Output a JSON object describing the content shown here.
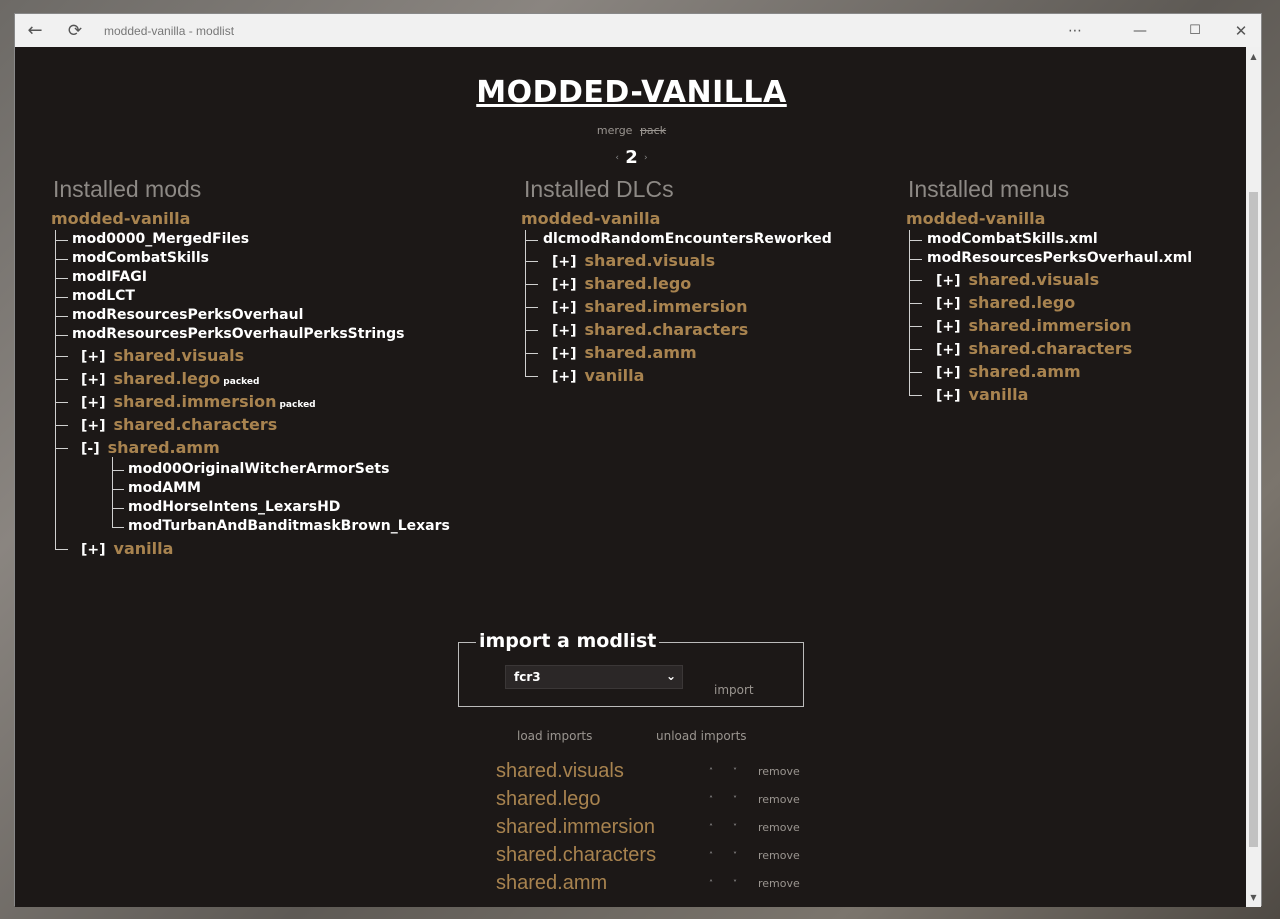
{
  "window": {
    "title": "modded-vanilla - modlist"
  },
  "page": {
    "title": "MODDED-VANILLA",
    "mode_merge": "merge",
    "mode_pack": "pack",
    "page_number": "2"
  },
  "columns": {
    "mods": {
      "heading": "Installed mods",
      "root": "modded-vanilla",
      "leaves": [
        "mod0000_MergedFiles",
        "modCombatSkills",
        "modIFAGI",
        "modLCT",
        "modResourcesPerksOverhaul",
        "modResourcesPerksOverhaulPerksStrings"
      ],
      "groups": [
        {
          "bracket": "[+]",
          "name": "shared.visuals",
          "tag": ""
        },
        {
          "bracket": "[+]",
          "name": "shared.lego",
          "tag": "packed"
        },
        {
          "bracket": "[+]",
          "name": "shared.immersion",
          "tag": "packed"
        },
        {
          "bracket": "[+]",
          "name": "shared.characters",
          "tag": ""
        },
        {
          "bracket": "[-]",
          "name": "shared.amm",
          "tag": ""
        }
      ],
      "amm_children": [
        "mod00OriginalWitcherArmorSets",
        "modAMM",
        "modHorseIntens_LexarsHD",
        "modTurbanAndBanditmaskBrown_Lexars"
      ],
      "last_group": {
        "bracket": "[+]",
        "name": "vanilla"
      }
    },
    "dlcs": {
      "heading": "Installed DLCs",
      "root": "modded-vanilla",
      "leaves": [
        "dlcmodRandomEncountersReworked"
      ],
      "groups": [
        {
          "bracket": "[+]",
          "name": "shared.visuals"
        },
        {
          "bracket": "[+]",
          "name": "shared.lego"
        },
        {
          "bracket": "[+]",
          "name": "shared.immersion"
        },
        {
          "bracket": "[+]",
          "name": "shared.characters"
        },
        {
          "bracket": "[+]",
          "name": "shared.amm"
        },
        {
          "bracket": "[+]",
          "name": "vanilla"
        }
      ]
    },
    "menus": {
      "heading": "Installed menus",
      "root": "modded-vanilla",
      "leaves": [
        "modCombatSkills.xml",
        "modResourcesPerksOverhaul.xml"
      ],
      "groups": [
        {
          "bracket": "[+]",
          "name": "shared.visuals"
        },
        {
          "bracket": "[+]",
          "name": "shared.lego"
        },
        {
          "bracket": "[+]",
          "name": "shared.immersion"
        },
        {
          "bracket": "[+]",
          "name": "shared.characters"
        },
        {
          "bracket": "[+]",
          "name": "shared.amm"
        },
        {
          "bracket": "[+]",
          "name": "vanilla"
        }
      ]
    }
  },
  "import": {
    "legend": "import a modlist",
    "selected": "fcr3",
    "import_label": "import",
    "load_label": "load imports",
    "unload_label": "unload imports"
  },
  "imports": [
    {
      "name": "shared.visuals",
      "up": "˄",
      "down": "˅",
      "remove": "remove"
    },
    {
      "name": "shared.lego",
      "up": "˄",
      "down": "˅",
      "remove": "remove"
    },
    {
      "name": "shared.immersion",
      "up": "˄",
      "down": "˅",
      "remove": "remove"
    },
    {
      "name": "shared.characters",
      "up": "˄",
      "down": "˅",
      "remove": "remove"
    },
    {
      "name": "shared.amm",
      "up": "˄",
      "down": "˅",
      "remove": "remove"
    }
  ]
}
